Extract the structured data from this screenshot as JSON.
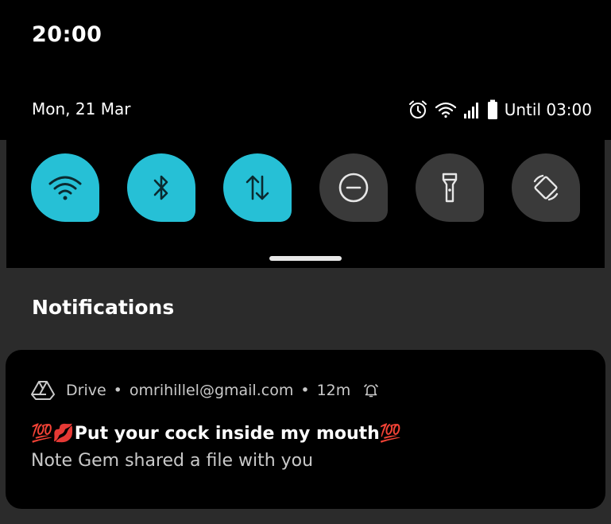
{
  "status_bar": {
    "time": "20:00"
  },
  "quick_settings": {
    "date": "Mon, 21 Mar",
    "until": "Until 03:00",
    "status_icons": [
      "alarm-icon",
      "wifi-signal-icon",
      "cell-signal-icon",
      "battery-icon"
    ],
    "tiles": [
      {
        "name": "wifi",
        "icon": "wifi-icon",
        "state": "on"
      },
      {
        "name": "bluetooth",
        "icon": "bluetooth-icon",
        "state": "on"
      },
      {
        "name": "mobile-data",
        "icon": "data-arrows-icon",
        "state": "on"
      },
      {
        "name": "do-not-disturb",
        "icon": "dnd-icon",
        "state": "off"
      },
      {
        "name": "flashlight",
        "icon": "flashlight-icon",
        "state": "off"
      },
      {
        "name": "auto-rotate",
        "icon": "rotate-icon",
        "state": "off"
      }
    ],
    "colors": {
      "tile_on": "#26c0d6",
      "tile_off": "#3a3a3a"
    }
  },
  "notifications": {
    "header": "Notifications",
    "items": [
      {
        "app": "Drive",
        "account": "omrihillel@gmail.com",
        "age": "12m",
        "separator": "•",
        "title": "💯💋Put your cock inside my mouth💯",
        "body": "Note Gem shared a file with you"
      }
    ]
  }
}
